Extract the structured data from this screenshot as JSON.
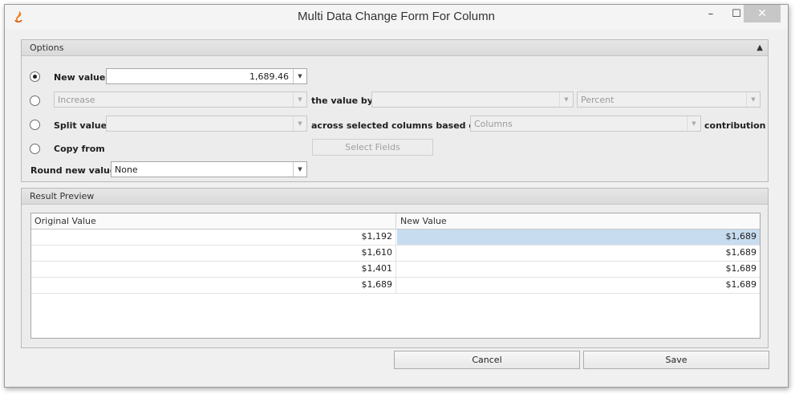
{
  "window": {
    "title": "Multi Data Change Form For Column",
    "controls": {
      "minimize": "–",
      "maximize": "☐",
      "close": "✕"
    }
  },
  "options": {
    "header": "Options",
    "new_value": {
      "label": "New value",
      "value": "1,689.46",
      "selected": true
    },
    "change_by": {
      "mode": "Increase",
      "label": "the value by",
      "amount": "",
      "unit": "Percent"
    },
    "split_value": {
      "label": "Split value",
      "value": "",
      "across_label": "across selected columns based on",
      "basis": "Columns",
      "contribution_label": "contribution"
    },
    "copy_from": {
      "label": "Copy from",
      "button": "Select Fields"
    },
    "round": {
      "label": "Round new value",
      "value": "None"
    }
  },
  "preview": {
    "header": "Result Preview",
    "columns": [
      "Original Value",
      "New Value"
    ],
    "rows": [
      {
        "original": "$1,192",
        "new": "$1,689",
        "selected": true
      },
      {
        "original": "$1,610",
        "new": "$1,689"
      },
      {
        "original": "$1,401",
        "new": "$1,689"
      },
      {
        "original": "$1,689",
        "new": "$1,689"
      }
    ]
  },
  "actions": {
    "cancel": "Cancel",
    "save": "Save"
  },
  "colors": {
    "selection": "#c8dcf0",
    "app_icon": "#f07b1e"
  }
}
